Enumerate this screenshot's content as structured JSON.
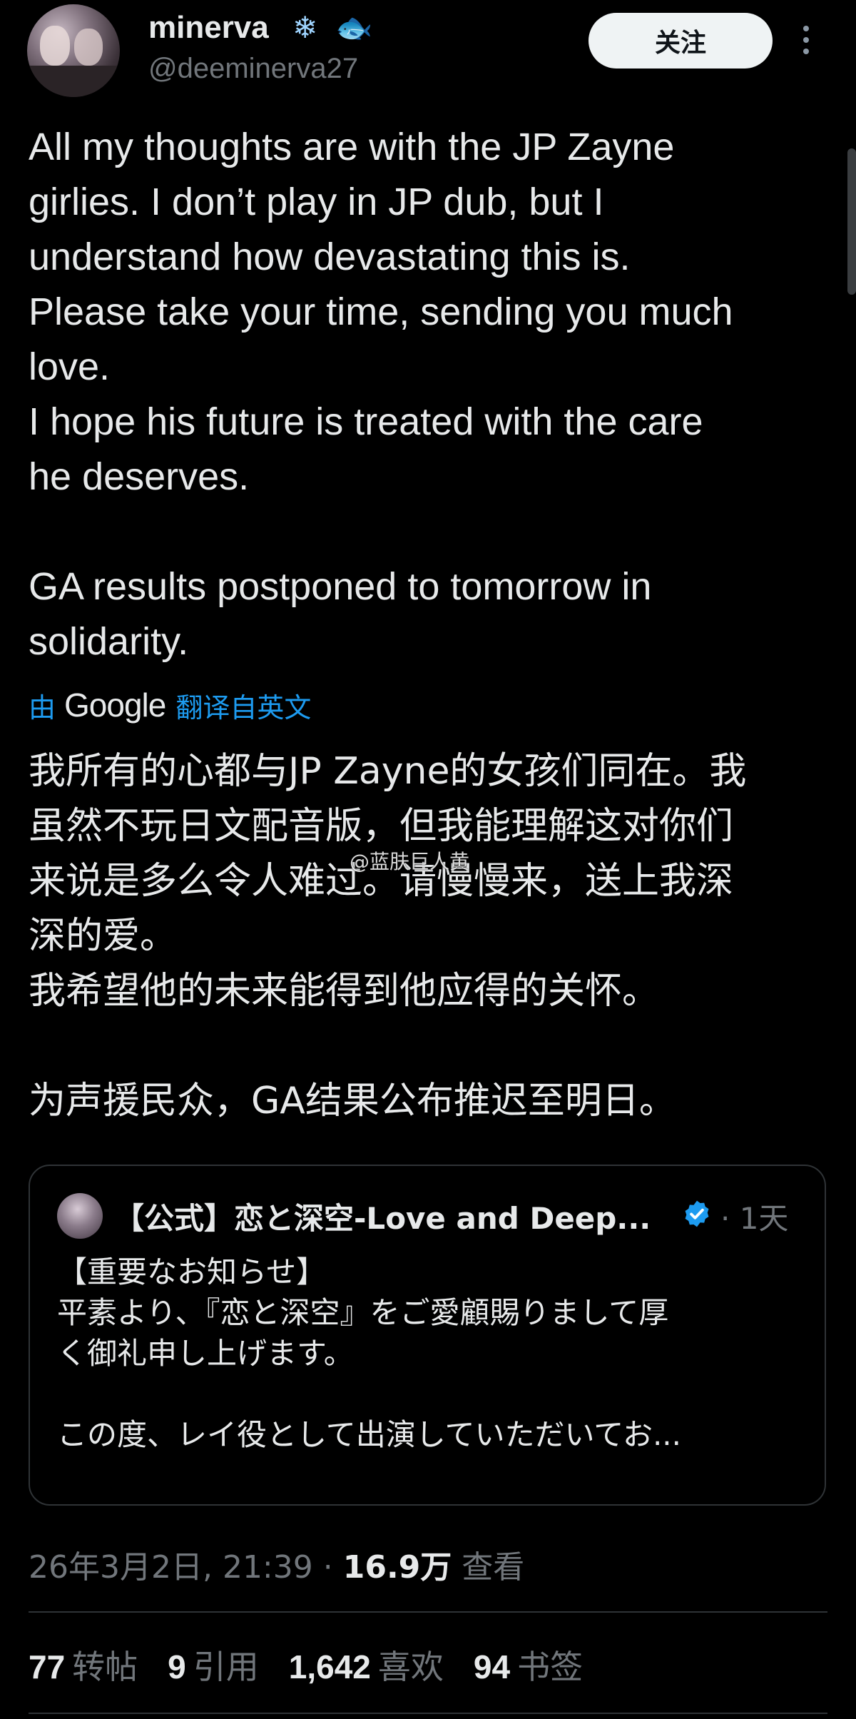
{
  "author": {
    "name": "minerva",
    "emoji_1": "❄",
    "emoji_2": "🐟",
    "handle": "@deeminerva27"
  },
  "header": {
    "follow_label": "关注"
  },
  "tweet": {
    "text": "All my thoughts are with the JP Zayne\ngirlies. I don’t play in JP dub, but I\nunderstand how devastating this is.\nPlease take your time, sending you much\nlove.\nI hope his future is treated with the care\nhe deserves.\n\nGA results postponed to tomorrow in\nsolidarity."
  },
  "translation": {
    "prefix": "由",
    "provider": "Google",
    "suffix": "翻译自英文",
    "text": "我所有的心都与JP Zayne的女孩们同在。我\n虽然不玩日文配音版，但我能理解这对你们\n来说是多么令人难过。请慢慢来，送上我深\n深的爱。\n我希望他的未来能得到他应得的关怀。\n\n为声援民众，GA结果公布推迟至明日。"
  },
  "watermark": "@蓝肤巨人黄",
  "quote": {
    "name": "【公式】恋と深空-Love and Deep...",
    "time": "· 1天",
    "text": "【重要なお知らせ】\n平素より、『恋と深空』をご愛顧賜りまして厚\nく御礼申し上げます。\n\nこの度、レイ役として出演していただいてお..."
  },
  "meta": {
    "datetime": "26年3月2日, 21:39",
    "separator": " · ",
    "views": "16.9万",
    "views_label": "查看"
  },
  "stats": [
    {
      "count": "77",
      "label": "转帖"
    },
    {
      "count": "9",
      "label": "引用"
    },
    {
      "count": "1,642",
      "label": "喜欢"
    },
    {
      "count": "94",
      "label": "书签"
    }
  ],
  "colors": {
    "background": "#000000",
    "text": "#e7e9ea",
    "muted": "#71767b",
    "link": "#1d9bf0",
    "verified": "#1d9bf0"
  }
}
